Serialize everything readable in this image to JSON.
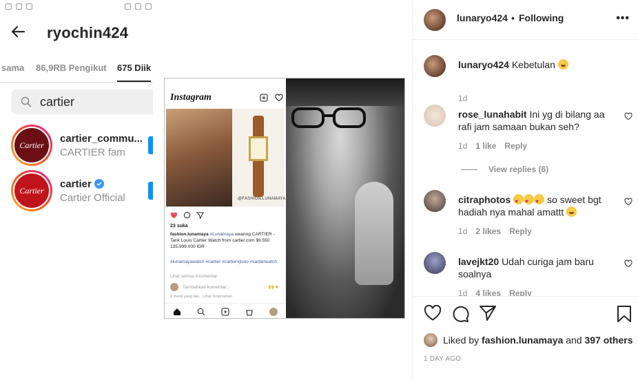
{
  "phone": {
    "title": "ryochin424",
    "tabs": {
      "mutual_partial": "sama",
      "followers": "86,9RB Pengikut",
      "following_partial": "675 Diik"
    },
    "search": {
      "value": "cartier"
    },
    "results": [
      {
        "handle": "cartier_commu...",
        "subtitle": "CARTIER fam",
        "avatar_text": "Cartier",
        "verified": false
      },
      {
        "handle": "cartier",
        "subtitle": "Cartier Official",
        "avatar_text": "Cartier",
        "verified": true
      }
    ]
  },
  "collage": {
    "ig_logo": "Instagram",
    "watermark": "@FASHION.LUNAMAYA",
    "likes": "23 suka",
    "caption_user": "fashion.lunamaya",
    "caption_tag": "#Lunamaya",
    "caption_rest": "wearing CARTIER - Tank Louis Cartier Watch from cartier.com $9.550 135.999.000 IDR",
    "hashtags": "#lunamayawatch #cartier #cartierxjisoo #cartierwatch",
    "view_all": "Lihat semua 4 komentar",
    "add_comment": "Tambahkan komentar...",
    "time": "9 menit yang lalu · Lihat Terjemahan"
  },
  "post": {
    "author": "lunaryo424",
    "separator": "•",
    "follow_status": "Following",
    "more_label": "•••",
    "comments": [
      {
        "user": "lunaryo424",
        "text": "Kebetulan",
        "emoji": "laugh",
        "time": "1d",
        "likes": "",
        "reply": ""
      },
      {
        "user": "rose_lunahabit",
        "text": "Ini yg di bilang aa rafi jam samaan bukan seh?",
        "emoji": "",
        "time": "1d",
        "likes": "1 like",
        "reply": "Reply"
      },
      {
        "user": "citraphotos",
        "text": "so sweet bgt hadiah nya mahal amattt",
        "emoji": "love",
        "time": "1d",
        "likes": "2 likes",
        "reply": "Reply"
      },
      {
        "user": "lavejkt20",
        "text": "Udah curiga jam baru soalnya",
        "emoji": "",
        "time": "1d",
        "likes": "4 likes",
        "reply": "Reply"
      }
    ],
    "view_replies": "View replies (6)",
    "liked_by_prefix": "Liked by",
    "liked_by_user": "fashion.lunamaya",
    "liked_by_and": "and",
    "liked_by_others": "397 others",
    "time_ago": "1 DAY AGO",
    "colors": {
      "heart": "#ed4956",
      "link": "#00376b",
      "muted": "#8e8e8e"
    }
  }
}
